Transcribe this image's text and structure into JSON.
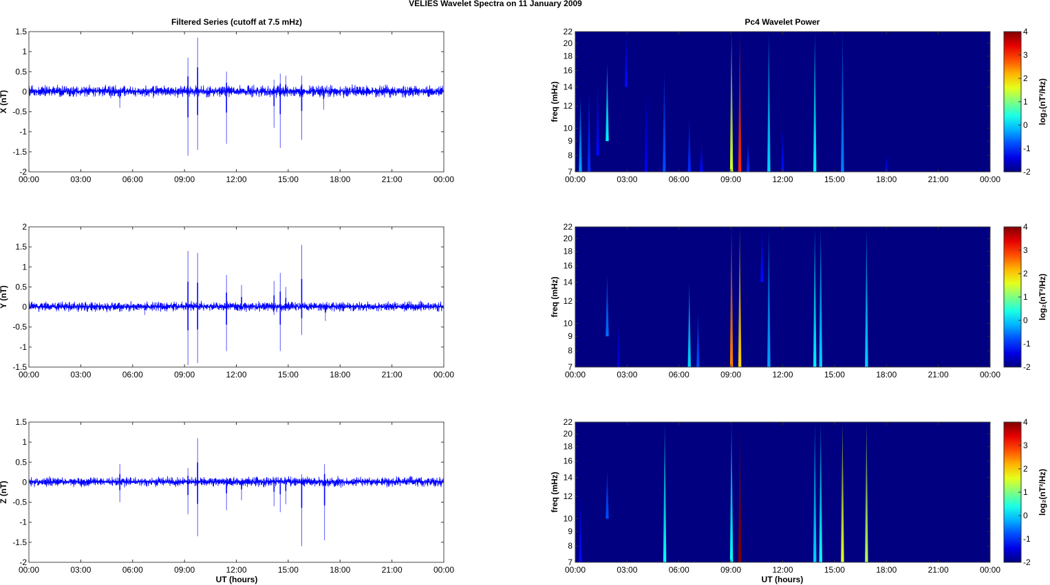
{
  "figure_title": "VELIES Wavelet Spectra on 11 January   2009",
  "chart_data": [
    {
      "type": "line",
      "title": "Filtered Series (cutoff at 7.5 mHz)",
      "xlabel": "",
      "ylabel": "X (nT)",
      "xlim": [
        0,
        24
      ],
      "ylim": [
        -2,
        1.5
      ],
      "yticks": [
        -2,
        -1.5,
        -1,
        -0.5,
        0,
        0.5,
        1,
        1.5
      ],
      "xticks": [
        "00:00",
        "03:00",
        "06:00",
        "09:00",
        "12:00",
        "15:00",
        "18:00",
        "21:00",
        "00:00"
      ],
      "noise_amplitude": 0.12,
      "color": "#0000ff",
      "spikes": [
        {
          "t": 5.26,
          "max": 0.05,
          "min": -0.4
        },
        {
          "t": 9.2,
          "max": 0.85,
          "min": -1.6
        },
        {
          "t": 9.76,
          "max": 1.35,
          "min": -1.45
        },
        {
          "t": 11.43,
          "max": 0.5,
          "min": -1.3
        },
        {
          "t": 14.18,
          "max": 0.3,
          "min": -0.9
        },
        {
          "t": 14.54,
          "max": 0.45,
          "min": -1.4
        },
        {
          "t": 14.86,
          "max": 0.4,
          "min": -0.1
        },
        {
          "t": 15.78,
          "max": 0.4,
          "min": -1.2
        },
        {
          "t": 17.05,
          "max": 0.1,
          "min": -0.45
        }
      ]
    },
    {
      "type": "line",
      "xlabel": "",
      "ylabel": "Y (nT)",
      "xlim": [
        0,
        24
      ],
      "ylim": [
        -1.5,
        2
      ],
      "yticks": [
        -1.5,
        -1,
        -0.5,
        0,
        0.5,
        1,
        1.5,
        2
      ],
      "xticks": [
        "00:00",
        "03:00",
        "06:00",
        "09:00",
        "12:00",
        "15:00",
        "18:00",
        "21:00",
        "00:00"
      ],
      "noise_amplitude": 0.1,
      "color": "#0000ff",
      "spikes": [
        {
          "t": 6.7,
          "max": 0.1,
          "min": -0.2
        },
        {
          "t": 9.2,
          "max": 1.4,
          "min": -1.45
        },
        {
          "t": 9.76,
          "max": 1.35,
          "min": -1.4
        },
        {
          "t": 11.43,
          "max": 0.8,
          "min": -1.1
        },
        {
          "t": 12.3,
          "max": 0.55,
          "min": -0.1
        },
        {
          "t": 14.18,
          "max": 0.65,
          "min": -0.2
        },
        {
          "t": 14.54,
          "max": 0.85,
          "min": -1.1
        },
        {
          "t": 14.86,
          "max": 0.5,
          "min": -0.1
        },
        {
          "t": 15.78,
          "max": 1.55,
          "min": -0.7
        },
        {
          "t": 17.15,
          "max": 0.1,
          "min": -0.35
        }
      ]
    },
    {
      "type": "line",
      "xlabel": "UT (hours)",
      "ylabel": "Z (nT)",
      "xlim": [
        0,
        24
      ],
      "ylim": [
        -2,
        1.5
      ],
      "yticks": [
        -2,
        -1.5,
        -1,
        -0.5,
        0,
        0.5,
        1,
        1.5
      ],
      "xticks": [
        "00:00",
        "03:00",
        "06:00",
        "09:00",
        "12:00",
        "15:00",
        "18:00",
        "21:00",
        "00:00"
      ],
      "noise_amplitude": 0.1,
      "color": "#0000ff",
      "spikes": [
        {
          "t": 5.26,
          "max": 0.45,
          "min": -0.5
        },
        {
          "t": 9.2,
          "max": 0.35,
          "min": -0.8
        },
        {
          "t": 9.76,
          "max": 1.1,
          "min": -1.35
        },
        {
          "t": 11.43,
          "max": 0.1,
          "min": -0.7
        },
        {
          "t": 12.3,
          "max": 0.1,
          "min": -0.45
        },
        {
          "t": 14.18,
          "max": 0.1,
          "min": -0.6
        },
        {
          "t": 14.54,
          "max": 0.1,
          "min": -0.75
        },
        {
          "t": 14.86,
          "max": 0.1,
          "min": -0.55
        },
        {
          "t": 15.78,
          "max": 0.2,
          "min": -1.6
        },
        {
          "t": 17.1,
          "max": 0.45,
          "min": -1.45
        }
      ]
    },
    {
      "type": "heatmap",
      "title": "Pc4 Wavelet Power",
      "ylabel": "freq (mHz)",
      "xlim": [
        0,
        24
      ],
      "ylim": [
        7,
        22
      ],
      "yscale": "log",
      "yticks": [
        7,
        8,
        9,
        10,
        12,
        14,
        16,
        18,
        20,
        22
      ],
      "xticks": [
        "00:00",
        "03:00",
        "06:00",
        "09:00",
        "12:00",
        "15:00",
        "18:00",
        "21:00",
        "00:00"
      ],
      "colorbar": {
        "label": "log₂(nT²/Hz)",
        "range": [
          -2,
          4
        ],
        "ticks": [
          -2,
          -1,
          0,
          1,
          2,
          3,
          4
        ]
      },
      "background_value": -2,
      "streaks": [
        {
          "t": 0.3,
          "power": -0.3,
          "fmin": 7,
          "fmax": 13
        },
        {
          "t": 0.8,
          "power": -1,
          "fmin": 7,
          "fmax": 14
        },
        {
          "t": 1.3,
          "power": -1.2,
          "fmin": 8,
          "fmax": 15
        },
        {
          "t": 1.85,
          "power": 0.2,
          "fmin": 9,
          "fmax": 17
        },
        {
          "t": 2.95,
          "power": -1.2,
          "fmin": 14,
          "fmax": 22
        },
        {
          "t": 4.1,
          "power": -1.3,
          "fmin": 7,
          "fmax": 14
        },
        {
          "t": 5.15,
          "power": -0.8,
          "fmin": 7,
          "fmax": 16
        },
        {
          "t": 6.6,
          "power": -1,
          "fmin": 7,
          "fmax": 11
        },
        {
          "t": 7.3,
          "power": -1.2,
          "fmin": 7,
          "fmax": 9
        },
        {
          "t": 9.04,
          "power": 1.5,
          "fmin": 7,
          "fmax": 22
        },
        {
          "t": 9.52,
          "power": 3,
          "fmin": 7,
          "fmax": 22
        },
        {
          "t": 10.0,
          "power": -1,
          "fmin": 7,
          "fmax": 9
        },
        {
          "t": 11.2,
          "power": 0,
          "fmin": 7,
          "fmax": 22
        },
        {
          "t": 12.0,
          "power": -1.2,
          "fmin": 7,
          "fmax": 10
        },
        {
          "t": 13.86,
          "power": 0.2,
          "fmin": 7,
          "fmax": 22
        },
        {
          "t": 15.46,
          "power": -0.5,
          "fmin": 7,
          "fmax": 22
        },
        {
          "t": 18.0,
          "power": -1.3,
          "fmin": 7,
          "fmax": 8
        }
      ]
    },
    {
      "type": "heatmap",
      "ylabel": "freq (mHz)",
      "xlim": [
        0,
        24
      ],
      "ylim": [
        7,
        22
      ],
      "yscale": "log",
      "yticks": [
        7,
        8,
        9,
        10,
        12,
        14,
        16,
        18,
        20,
        22
      ],
      "xticks": [
        "00:00",
        "03:00",
        "06:00",
        "09:00",
        "12:00",
        "15:00",
        "18:00",
        "21:00",
        "00:00"
      ],
      "colorbar": {
        "label": "log₂(nT²/Hz)",
        "range": [
          -2,
          4
        ],
        "ticks": [
          -2,
          -1,
          0,
          1,
          2,
          3,
          4
        ]
      },
      "background_value": -2,
      "streaks": [
        {
          "t": 1.85,
          "power": -0.6,
          "fmin": 9,
          "fmax": 15
        },
        {
          "t": 2.5,
          "power": -1.4,
          "fmin": 7,
          "fmax": 10
        },
        {
          "t": 6.6,
          "power": 0,
          "fmin": 7,
          "fmax": 14
        },
        {
          "t": 7.1,
          "power": -0.8,
          "fmin": 7,
          "fmax": 11
        },
        {
          "t": 9.04,
          "power": 2.5,
          "fmin": 7,
          "fmax": 22
        },
        {
          "t": 9.52,
          "power": 2,
          "fmin": 7,
          "fmax": 22
        },
        {
          "t": 10.8,
          "power": -1.2,
          "fmin": 14,
          "fmax": 22
        },
        {
          "t": 11.2,
          "power": -0.3,
          "fmin": 7,
          "fmax": 22
        },
        {
          "t": 13.86,
          "power": 0.2,
          "fmin": 7,
          "fmax": 22
        },
        {
          "t": 14.2,
          "power": 0,
          "fmin": 7,
          "fmax": 22
        },
        {
          "t": 16.85,
          "power": 0,
          "fmin": 7,
          "fmax": 22
        }
      ]
    },
    {
      "type": "heatmap",
      "xlabel": "UT (hours)",
      "ylabel": "freq (mHz)",
      "xlim": [
        0,
        24
      ],
      "ylim": [
        7,
        22
      ],
      "yscale": "log",
      "yticks": [
        7,
        8,
        9,
        10,
        12,
        14,
        16,
        18,
        20,
        22
      ],
      "xticks": [
        "00:00",
        "03:00",
        "06:00",
        "09:00",
        "12:00",
        "15:00",
        "18:00",
        "21:00",
        "00:00"
      ],
      "colorbar": {
        "label": "log₂(nT²/Hz)",
        "range": [
          -2,
          4
        ],
        "ticks": [
          -2,
          -1,
          0,
          1,
          2,
          3,
          4
        ]
      },
      "background_value": -2,
      "streaks": [
        {
          "t": 0.3,
          "power": -1.2,
          "fmin": 7,
          "fmax": 12
        },
        {
          "t": 1.85,
          "power": -0.8,
          "fmin": 10,
          "fmax": 15
        },
        {
          "t": 5.18,
          "power": 0.3,
          "fmin": 7,
          "fmax": 22
        },
        {
          "t": 9.04,
          "power": 0.3,
          "fmin": 7,
          "fmax": 22
        },
        {
          "t": 9.52,
          "power": 4,
          "fmin": 7,
          "fmax": 22
        },
        {
          "t": 13.86,
          "power": 0,
          "fmin": 7,
          "fmax": 22
        },
        {
          "t": 14.2,
          "power": 0.3,
          "fmin": 7,
          "fmax": 22
        },
        {
          "t": 15.46,
          "power": 1.6,
          "fmin": 7,
          "fmax": 22
        },
        {
          "t": 16.85,
          "power": 1.3,
          "fmin": 7,
          "fmax": 22
        }
      ]
    }
  ]
}
